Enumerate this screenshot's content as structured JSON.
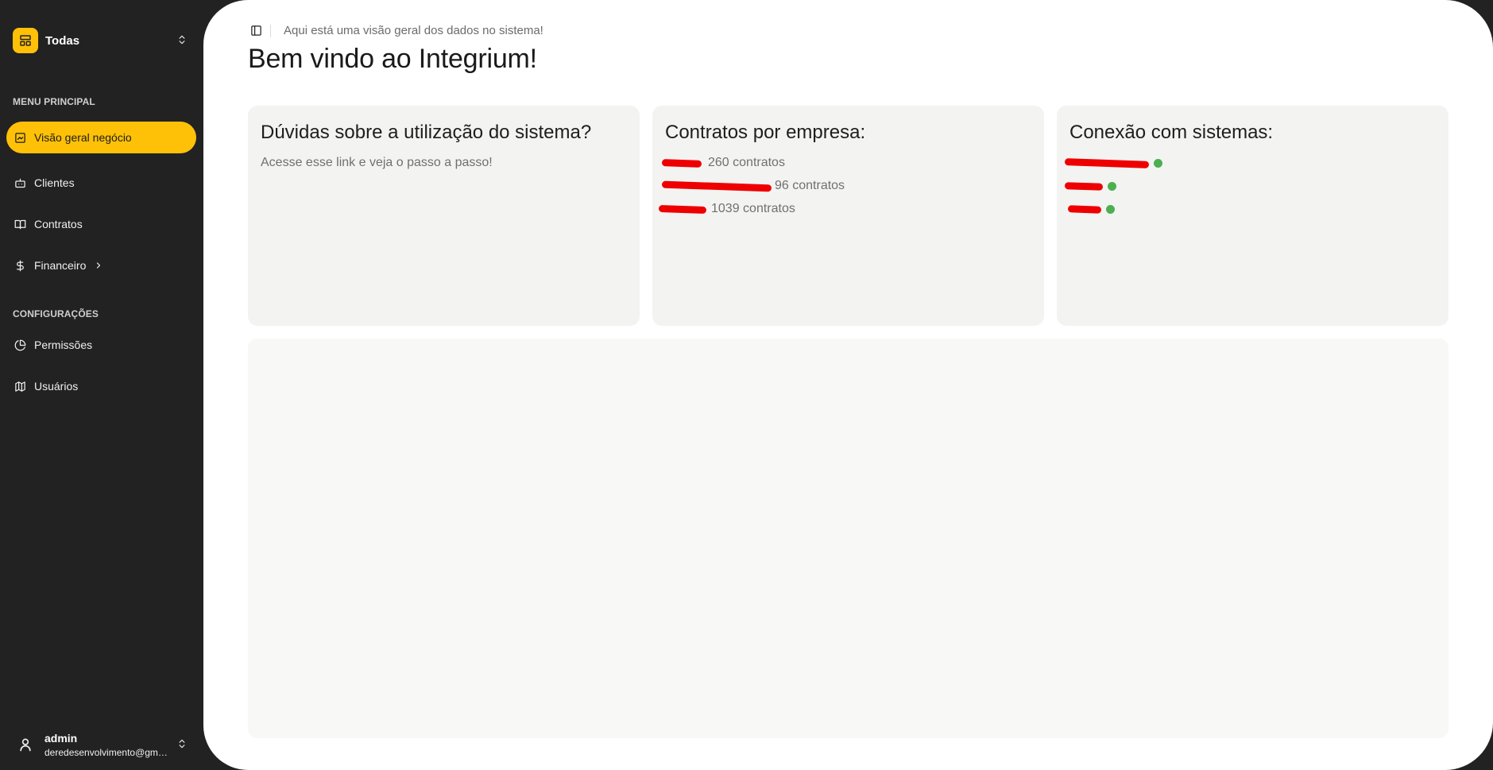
{
  "sidebar": {
    "org_switcher": {
      "label": "Todas"
    },
    "sections": [
      {
        "label": "MENU PRINCIPAL",
        "items": [
          {
            "label": "Visão geral negócio",
            "icon": "dashboard-icon",
            "active": true
          },
          {
            "label": "Clientes",
            "icon": "bot-icon"
          },
          {
            "label": "Contratos",
            "icon": "book-icon"
          },
          {
            "label": "Financeiro",
            "icon": "dollar-icon",
            "has_submenu": true
          }
        ]
      },
      {
        "label": "CONFIGURAÇÕES",
        "items": [
          {
            "label": "Permissões",
            "icon": "pie-chart-icon"
          },
          {
            "label": "Usuários",
            "icon": "map-icon"
          }
        ]
      }
    ],
    "user": {
      "name": "admin",
      "email": "deredesenvolvimento@gmail.com"
    }
  },
  "header": {
    "subtitle": "Aqui está uma visão geral dos dados no sistema!",
    "title": "Bem vindo ao Integrium!"
  },
  "cards": {
    "help": {
      "title": "Dúvidas sobre a utilização do sistema?",
      "link_text": "Acesse esse link e veja o passo a passo!"
    },
    "contracts": {
      "title": "Contratos por empresa:",
      "rows": [
        {
          "count_text": "260 contratos"
        },
        {
          "count_text": "96 contratos"
        },
        {
          "count_text": "1039 contratos"
        }
      ]
    },
    "connections": {
      "title": "Conexão com sistemas:",
      "rows": [
        {
          "status": "connected",
          "status_color": "#4caf50"
        },
        {
          "status": "connected",
          "status_color": "#4caf50"
        },
        {
          "status": "connected",
          "status_color": "#4caf50"
        }
      ]
    }
  },
  "colors": {
    "accent": "#ffc107",
    "sidebar_bg": "#222222",
    "card_bg": "#f3f3f2",
    "status_ok": "#4caf50",
    "redaction": "#ee0000"
  }
}
